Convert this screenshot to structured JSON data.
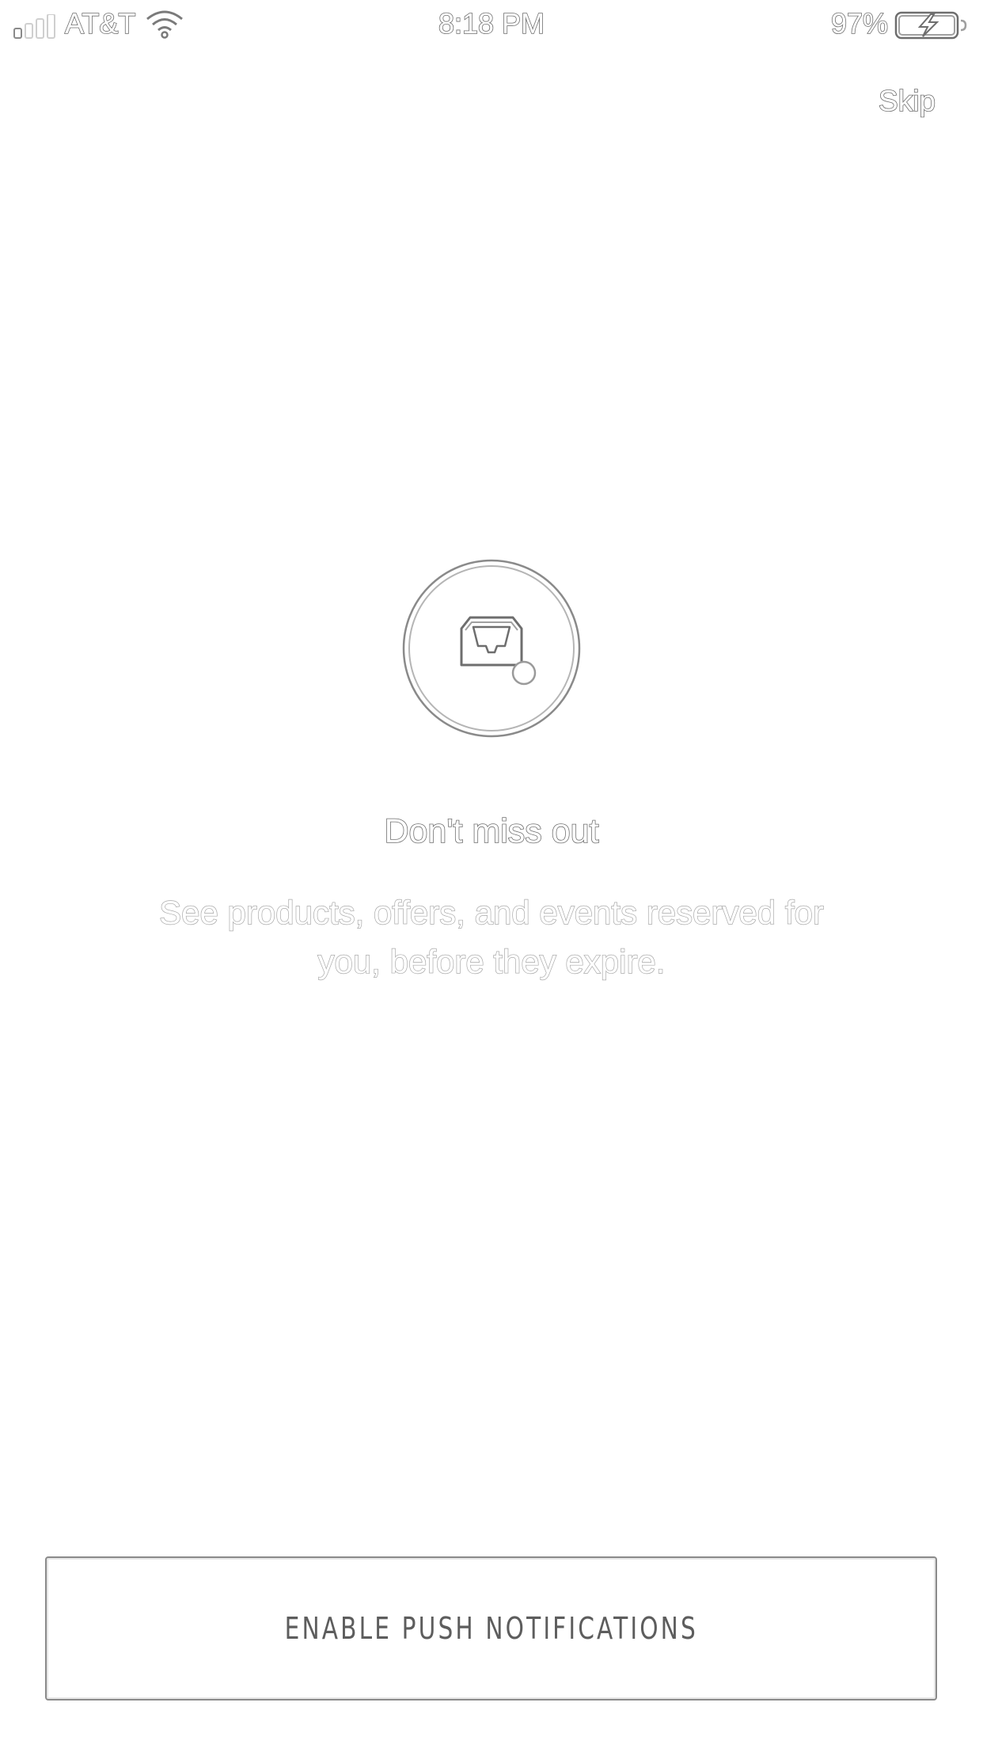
{
  "status_bar": {
    "carrier": "AT&T",
    "time": "8:18 PM",
    "battery_percent": "97%",
    "signal_icon": "signal-bars-icon",
    "wifi_icon": "wifi-icon",
    "battery_icon": "battery-charging-icon"
  },
  "header": {
    "skip_label": "Skip"
  },
  "hero": {
    "icon": "inbox-tray-icon",
    "title": "Don't miss out",
    "subtitle": "See products, offers, and events reserved for you, before they expire."
  },
  "cta": {
    "label": "ENABLE PUSH NOTIFICATIONS"
  }
}
